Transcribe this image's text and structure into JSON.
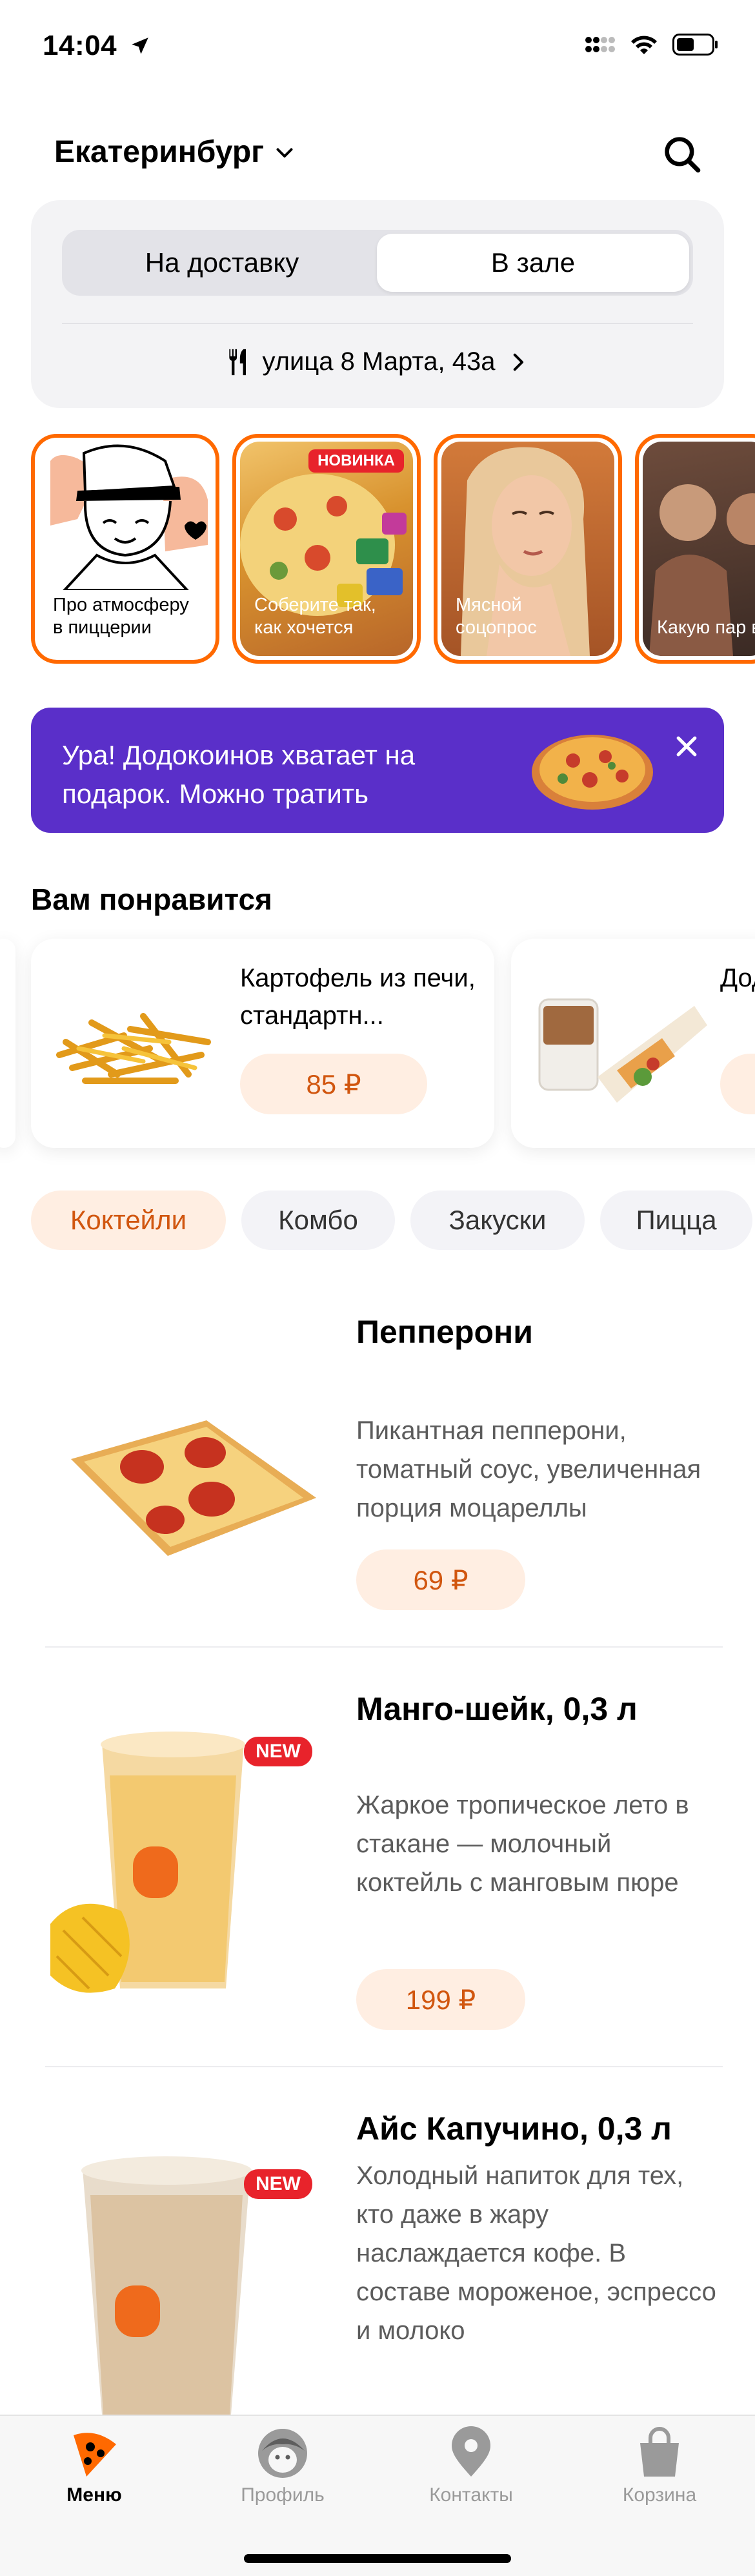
{
  "status_bar": {
    "time": "14:04"
  },
  "header": {
    "city": "Екатеринбург"
  },
  "order_mode": {
    "delivery_label": "На доставку",
    "hall_label": "В зале",
    "selected": "В зале",
    "address": "улица 8 Марта, 43а"
  },
  "stories": [
    {
      "label": "Про атмосферу в пиццерии"
    },
    {
      "label": "Соберите так, как хочется",
      "badge": "НОВИНКА"
    },
    {
      "label": "Мясной соцопрос"
    },
    {
      "label": "Какую пар выбрать?"
    }
  ],
  "promo": {
    "text": "Ура! Додокоинов хватает на подарок. Можно тратить"
  },
  "recommendations": {
    "title": "Вам понравится",
    "items": [
      {
        "name": "Картофель из печи, стандартн...",
        "price": "85 ₽"
      },
      {
        "name": "Дод нап",
        "price": ""
      }
    ]
  },
  "categories": [
    {
      "label": "Коктейли",
      "active": true
    },
    {
      "label": "Комбо",
      "active": false
    },
    {
      "label": "Закуски",
      "active": false
    },
    {
      "label": "Пицца",
      "active": false
    }
  ],
  "products": [
    {
      "title": "Пепперони",
      "description": "Пикантная пепперони, томатный соус, увеличенная порция моцареллы",
      "price": "69 ₽",
      "badge": ""
    },
    {
      "title": "Манго-шейк, 0,3 л",
      "description": "Жаркое тропическое лето в стакане — молочный коктейль с манговым пюре",
      "price": "199 ₽",
      "badge": "NEW"
    },
    {
      "title": "Айс Капучино, 0,3 л",
      "description": "Холодный напиток для тех, кто даже в жару наслаждается кофе. В составе мороженое, эспрессо и молоко",
      "price": "",
      "badge": "NEW"
    }
  ],
  "tabbar": [
    {
      "label": "Меню",
      "icon": "pizza-slice-icon",
      "active": true
    },
    {
      "label": "Профиль",
      "icon": "face-icon",
      "active": false
    },
    {
      "label": "Контакты",
      "icon": "map-pin-icon",
      "active": false
    },
    {
      "label": "Корзина",
      "icon": "shopping-bag-icon",
      "active": false
    }
  ],
  "colors": {
    "accent": "#ff6900",
    "price_text": "#d1560f",
    "price_bg": "#ffeee2",
    "promo_bg": "#5a2fc9",
    "badge_red": "#e8232b"
  }
}
